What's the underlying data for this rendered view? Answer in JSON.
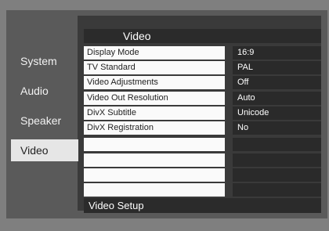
{
  "header": {
    "title": "Video"
  },
  "sidebar": {
    "items": [
      {
        "label": "System"
      },
      {
        "label": "Audio"
      },
      {
        "label": "Speaker"
      },
      {
        "label": "Video",
        "active": true
      }
    ]
  },
  "rows": [
    {
      "label": "Display Mode",
      "value": "16:9"
    },
    {
      "label": "TV Standard",
      "value": "PAL"
    },
    {
      "label": "Video Adjustments",
      "value": "Off"
    },
    {
      "label": "Video Out Resolution",
      "value": "Auto"
    },
    {
      "label": "DivX Subtitle",
      "value": "Unicode"
    },
    {
      "label": "DivX Registration",
      "value": "No"
    },
    {
      "label": "",
      "value": ""
    },
    {
      "label": "",
      "value": ""
    },
    {
      "label": "",
      "value": ""
    },
    {
      "label": "",
      "value": ""
    }
  ],
  "footer": {
    "text": "Video Setup"
  }
}
